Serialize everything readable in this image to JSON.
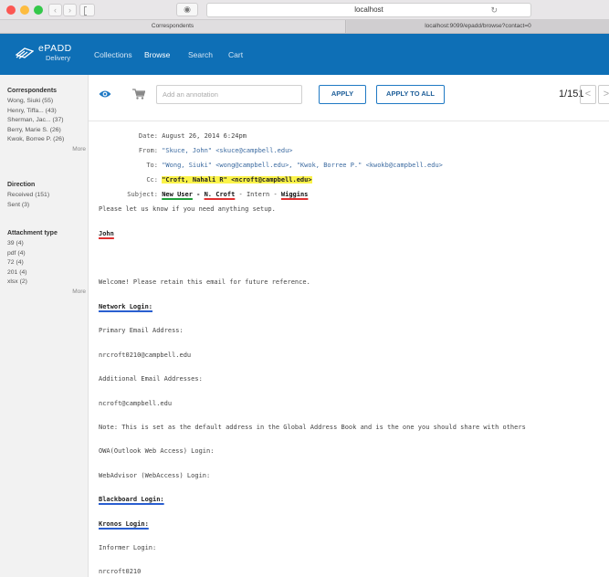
{
  "browser": {
    "url": "localhost",
    "tabs": [
      "Correspondents",
      "localhost:9099/epadd/browse?contact=0"
    ]
  },
  "app": {
    "logo_name": "ePADD",
    "logo_sub": "Delivery",
    "nav": [
      "Collections",
      "Browse",
      "Search",
      "Cart"
    ]
  },
  "sidebar": {
    "correspondents": {
      "title": "Correspondents",
      "items": [
        "Wong, Siuki (55)",
        "Henry, Tiffa... (43)",
        "Sherman, Jac... (37)",
        "Berry, Marie S. (26)",
        "Kwok, Borree P. (26)"
      ],
      "more": "More"
    },
    "direction": {
      "title": "Direction",
      "items": [
        "Received (151)",
        "Sent (3)"
      ]
    },
    "attachment": {
      "title": "Attachment type",
      "items": [
        "39 (4)",
        "pdf (4)",
        "72 (4)",
        "201 (4)",
        "xlsx (2)"
      ],
      "more": "More"
    }
  },
  "toolbar": {
    "annotation_placeholder": "Add an annotation",
    "apply": "APPLY",
    "apply_all": "APPLY TO ALL",
    "counter": "1/151",
    "prev": "<",
    "next": ">"
  },
  "message": {
    "date_label": "Date:",
    "date": "August 26, 2014 6:24pm",
    "from_label": "From:",
    "from": "\"Skuce, John\" <skuce@campbell.edu>",
    "to_label": "To:",
    "to": "\"Wong, Siuki\" <wong@campbell.edu>, \"Kwok, Borree P.\" <kwokb@campbell.edu>",
    "cc_label": "Cc:",
    "cc": "\"Croft, Nahali R\" <ncroft@campbell.edu>",
    "subject_label": "Subject:",
    "subject_parts": [
      "New User",
      " - ",
      "N. Croft",
      " - Intern - ",
      "Wiggins"
    ],
    "body": [
      "Please let us know if you need anything setup.",
      "John",
      "Welcome! Please retain this email for future reference.",
      "Network Login:",
      "Primary Email Address:",
      "nrcroft0210@campbell.edu",
      "Additional Email Addresses:",
      "ncroft@campbell.edu",
      "Note: This is set as the default address in the Global Address Book and is the one you should share with others",
      "OWA(Outlook Web Access) Login:",
      "WebAdvisor (WebAccess) Login:",
      "Blackboard Login:",
      "Kronos Login:",
      "Informer Login:",
      "nrcroft0210"
    ]
  },
  "colors": {
    "brand": "#0e6fb6",
    "highlight": "#fbf349",
    "underline_green": "#1e9e3a",
    "underline_red": "#e03030",
    "underline_blue": "#2a5fd0"
  }
}
